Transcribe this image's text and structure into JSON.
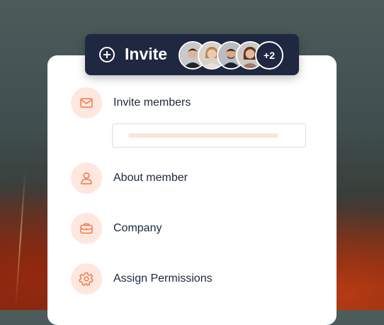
{
  "invite": {
    "label": "Invite",
    "more_count": "+2"
  },
  "menu": [
    {
      "label": "Invite members",
      "icon": "mail-icon"
    },
    {
      "label": "About member",
      "icon": "user-icon"
    },
    {
      "label": "Company",
      "icon": "briefcase-icon"
    },
    {
      "label": "Assign Permissions",
      "icon": "gear-icon"
    }
  ],
  "colors": {
    "accent": "#f07a4a",
    "accent_light": "#fde7de",
    "navy": "#1f2840"
  }
}
